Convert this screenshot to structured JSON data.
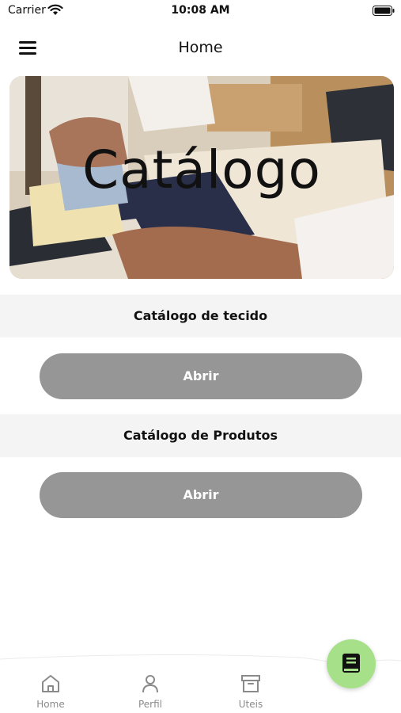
{
  "status_bar": {
    "carrier": "Carrier",
    "time": "10:08 AM"
  },
  "header": {
    "title": "Home",
    "menu_icon": "hamburger-menu-icon"
  },
  "hero": {
    "title": "Catálogo"
  },
  "sections": [
    {
      "title": "Catálogo de tecido",
      "button_label": "Abrir"
    },
    {
      "title": "Catálogo de Produtos",
      "button_label": "Abrir"
    }
  ],
  "fab": {
    "icon": "book-icon",
    "color": "#a6e18a"
  },
  "bottom_nav": {
    "items": [
      {
        "label": "Home",
        "icon": "home-icon"
      },
      {
        "label": "Perfil",
        "icon": "person-icon"
      },
      {
        "label": "Uteis",
        "icon": "archive-box-icon"
      }
    ]
  },
  "colors": {
    "button": "#969696",
    "section_background": "#f4f4f4",
    "nav_label": "#8a8a8a"
  }
}
